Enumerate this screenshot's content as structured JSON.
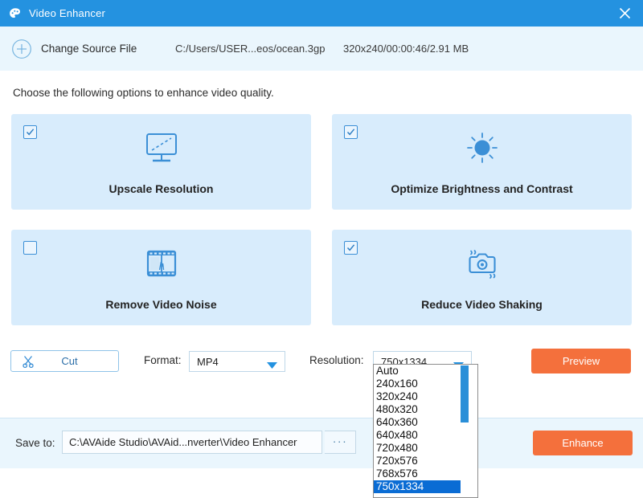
{
  "window": {
    "title": "Video Enhancer",
    "app_icon": "palette-icon",
    "close_icon": "close-icon",
    "accent_blue": "#2492e0",
    "accent_orange": "#f4703c",
    "card_bg": "#d8ecfc"
  },
  "source_bar": {
    "add_icon": "plus-circle-icon",
    "change_source_label": "Change Source File",
    "path": "C:/Users/USER...eos/ocean.3gp",
    "meta": "320x240/00:00:46/2.91 MB"
  },
  "main": {
    "instruction": "Choose the following options to enhance video quality.",
    "options": [
      {
        "label": "Upscale Resolution",
        "checked": true,
        "icon": "monitor-upscale-icon"
      },
      {
        "label": "Optimize Brightness and Contrast",
        "checked": true,
        "icon": "sun-brightness-icon"
      },
      {
        "label": "Remove Video Noise",
        "checked": false,
        "icon": "film-strip-noise-icon"
      },
      {
        "label": "Reduce Video Shaking",
        "checked": true,
        "icon": "camera-stabilize-icon"
      }
    ]
  },
  "controls": {
    "cut_label": "Cut",
    "cut_icon": "scissors-icon",
    "format_label": "Format:",
    "format_value": "MP4",
    "resolution_label": "Resolution:",
    "resolution_value": "750x1334",
    "caret_icon": "chevron-down-icon",
    "preview_label": "Preview"
  },
  "resolution_dropdown": {
    "open": true,
    "options": [
      "Auto",
      "240x160",
      "320x240",
      "480x320",
      "640x360",
      "640x480",
      "720x480",
      "720x576",
      "768x576",
      "750x1334"
    ],
    "selected": "750x1334",
    "selected_index": 9
  },
  "bottom_bar": {
    "save_to_label": "Save to:",
    "save_to_value": "C:\\AVAide Studio\\AVAid...nverter\\Video Enhancer",
    "browse_label": "···",
    "enhance_label": "Enhance"
  }
}
